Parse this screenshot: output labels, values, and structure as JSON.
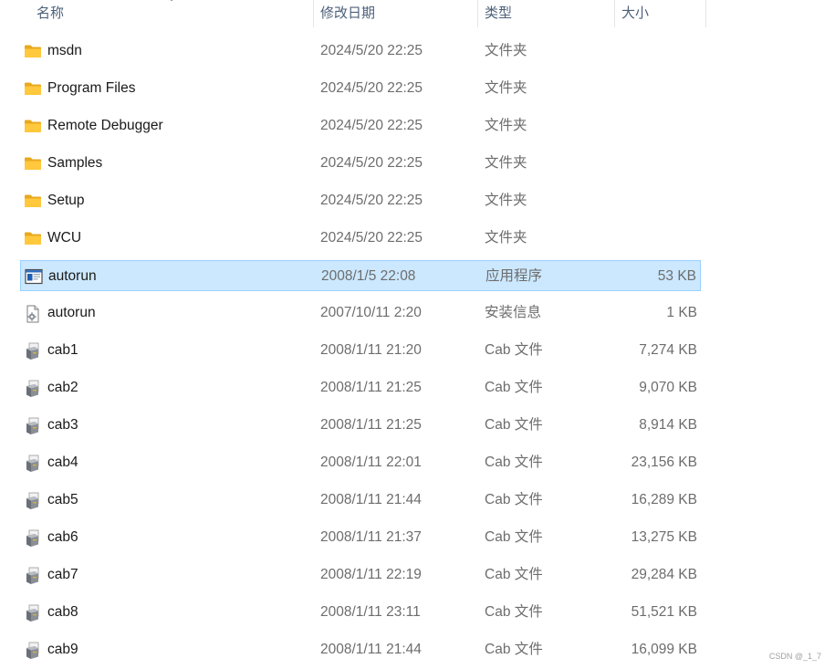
{
  "header": {
    "name": "名称",
    "date": "修改日期",
    "type": "类型",
    "size": "大小"
  },
  "files": [
    {
      "name": "msdn",
      "date": "2024/5/20 22:25",
      "type": "文件夹",
      "size": "",
      "icon": "folder-icon",
      "selected": false
    },
    {
      "name": "Program Files",
      "date": "2024/5/20 22:25",
      "type": "文件夹",
      "size": "",
      "icon": "folder-icon",
      "selected": false
    },
    {
      "name": "Remote Debugger",
      "date": "2024/5/20 22:25",
      "type": "文件夹",
      "size": "",
      "icon": "folder-icon",
      "selected": false
    },
    {
      "name": "Samples",
      "date": "2024/5/20 22:25",
      "type": "文件夹",
      "size": "",
      "icon": "folder-icon",
      "selected": false
    },
    {
      "name": "Setup",
      "date": "2024/5/20 22:25",
      "type": "文件夹",
      "size": "",
      "icon": "folder-icon",
      "selected": false
    },
    {
      "name": "WCU",
      "date": "2024/5/20 22:25",
      "type": "文件夹",
      "size": "",
      "icon": "folder-icon",
      "selected": false
    },
    {
      "name": "autorun",
      "date": "2008/1/5 22:08",
      "type": "应用程序",
      "size": "53 KB",
      "icon": "application-icon",
      "selected": true
    },
    {
      "name": "autorun",
      "date": "2007/10/11 2:20",
      "type": "安装信息",
      "size": "1 KB",
      "icon": "setup-info-icon",
      "selected": false
    },
    {
      "name": "cab1",
      "date": "2008/1/11 21:20",
      "type": "Cab 文件",
      "size": "7,274 KB",
      "icon": "cab-file-icon",
      "selected": false
    },
    {
      "name": "cab2",
      "date": "2008/1/11 21:25",
      "type": "Cab 文件",
      "size": "9,070 KB",
      "icon": "cab-file-icon",
      "selected": false
    },
    {
      "name": "cab3",
      "date": "2008/1/11 21:25",
      "type": "Cab 文件",
      "size": "8,914 KB",
      "icon": "cab-file-icon",
      "selected": false
    },
    {
      "name": "cab4",
      "date": "2008/1/11 22:01",
      "type": "Cab 文件",
      "size": "23,156 KB",
      "icon": "cab-file-icon",
      "selected": false
    },
    {
      "name": "cab5",
      "date": "2008/1/11 21:44",
      "type": "Cab 文件",
      "size": "16,289 KB",
      "icon": "cab-file-icon",
      "selected": false
    },
    {
      "name": "cab6",
      "date": "2008/1/11 21:37",
      "type": "Cab 文件",
      "size": "13,275 KB",
      "icon": "cab-file-icon",
      "selected": false
    },
    {
      "name": "cab7",
      "date": "2008/1/11 22:19",
      "type": "Cab 文件",
      "size": "29,284 KB",
      "icon": "cab-file-icon",
      "selected": false
    },
    {
      "name": "cab8",
      "date": "2008/1/11 23:11",
      "type": "Cab 文件",
      "size": "51,521 KB",
      "icon": "cab-file-icon",
      "selected": false
    },
    {
      "name": "cab9",
      "date": "2008/1/11 21:44",
      "type": "Cab 文件",
      "size": "16,099 KB",
      "icon": "cab-file-icon",
      "selected": false
    }
  ],
  "watermark": "CSDN @_1_7",
  "colors": {
    "selection_bg": "#cce8ff",
    "selection_border": "#99d1ff",
    "header_text": "#4c607a",
    "folder_yellow": "#ffc83d"
  }
}
